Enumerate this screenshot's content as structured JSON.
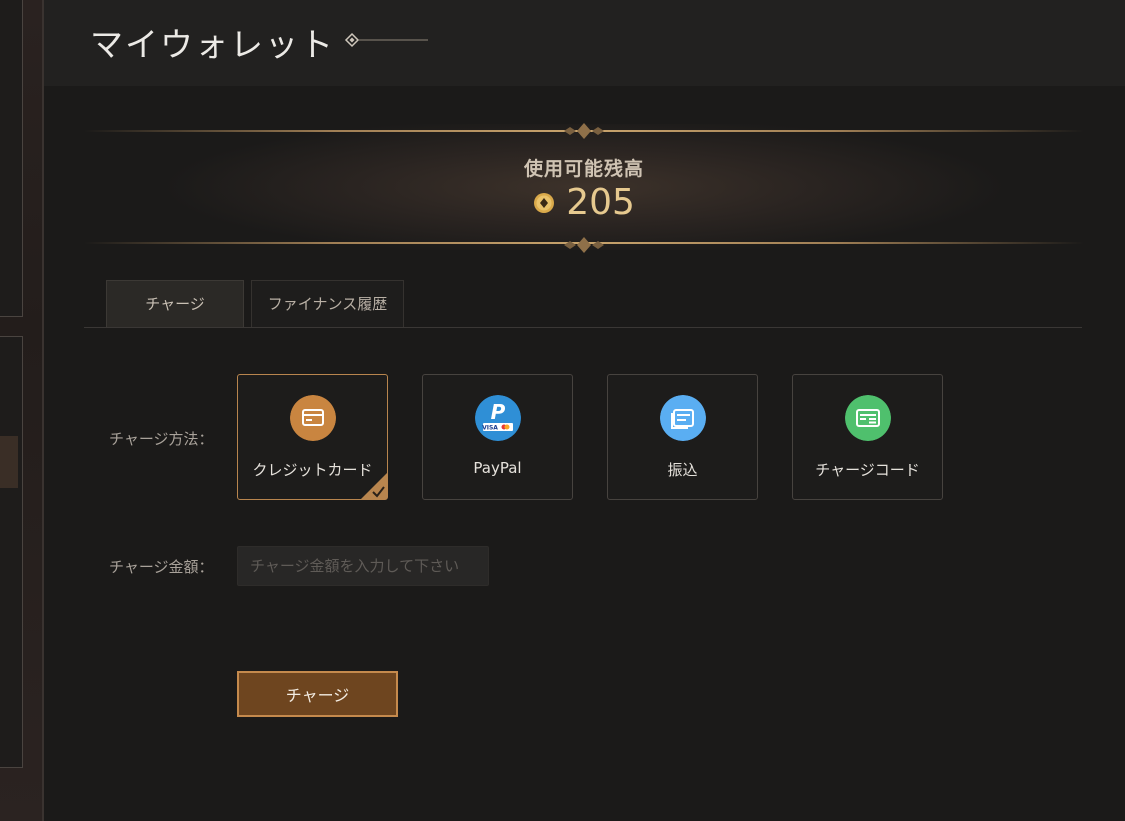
{
  "page": {
    "title": "マイウォレット"
  },
  "balance": {
    "label": "使用可能残高",
    "value": "205",
    "coin_icon": "coin-icon",
    "accent_color": "#e6c98f"
  },
  "tabs": [
    {
      "label": "チャージ",
      "selected": true
    },
    {
      "label": "ファイナンス履歴",
      "selected": false
    }
  ],
  "charge_form": {
    "method_label": "チャージ方法：",
    "methods": [
      {
        "label": "クレジットカード",
        "icon": "credit-card-icon",
        "color": "#c98540",
        "selected": true
      },
      {
        "label": "PayPal",
        "icon": "paypal-icon",
        "color": "#2f8fd6",
        "selected": false
      },
      {
        "label": "振込",
        "icon": "bank-transfer-icon",
        "color": "#5aaef2",
        "selected": false
      },
      {
        "label": "チャージコード",
        "icon": "charge-code-icon",
        "color": "#4fc06d",
        "selected": false
      }
    ],
    "amount_label": "チャージ金額：",
    "amount_value": "",
    "amount_placeholder": "チャージ金額を入力して下さい",
    "submit_label": "チャージ"
  }
}
